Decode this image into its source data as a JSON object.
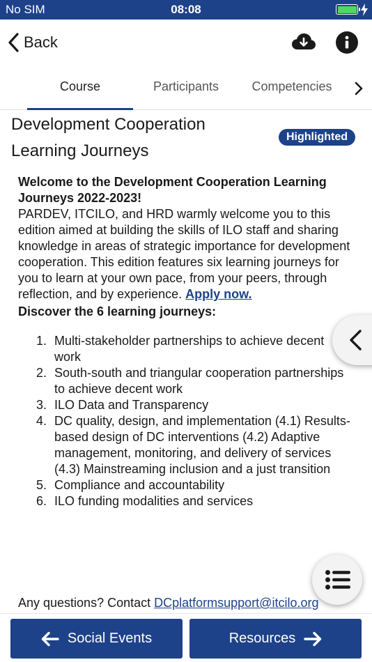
{
  "status_bar": {
    "carrier": "No SIM",
    "time": "08:08",
    "battery_level": 1.0
  },
  "nav": {
    "back_label": "Back",
    "download_icon": "cloud-download-icon",
    "info_icon": "info-icon"
  },
  "tabs": [
    {
      "label": "Course",
      "selected": true
    },
    {
      "label": "Participants",
      "selected": false
    },
    {
      "label": "Competencies",
      "selected": false
    }
  ],
  "course": {
    "title": "Development Cooperation Learning Journeys",
    "badge": "Highlighted",
    "welcome": "Welcome to the Development Cooperation Learning Journeys 2022-2023!",
    "intro": "PARDEV, ITCILO, and HRD warmly welcome you to this edition aimed at building the skills of ILO staff and sharing knowledge in areas of strategic importance for development cooperation. This edition features six learning journeys for you to learn at your own pace, from your peers, through reflection, and by experience.",
    "apply_link": "Apply now.",
    "discover": "Discover the 6 learning journeys:",
    "journeys": [
      {
        "num": "1.",
        "text": "Multi-stakeholder partnerships to achieve decent work"
      },
      {
        "num": "2.",
        "text": "South-south and triangular cooperation partnerships to achieve decent work"
      },
      {
        "num": "3.",
        "text": "ILO Data and Transparency"
      },
      {
        "num": "4.",
        "text": "DC quality, design, and implementation (4.1) Results-based design of DC interventions (4.2) Adaptive management, monitoring, and delivery of services (4.3) Mainstreaming inclusion and a just transition"
      },
      {
        "num": "5.",
        "text": "Compliance and accountability"
      },
      {
        "num": "6.",
        "text": "ILO funding modalities and services"
      }
    ],
    "contact_prefix": "Any questions? Contact ",
    "contact_email": "DCplatformsupport@itcilo.org"
  },
  "bottom": {
    "prev_label": "Social Events",
    "next_label": "Resources"
  },
  "colors": {
    "primary": "#1e4289",
    "battery": "#4cd964"
  }
}
